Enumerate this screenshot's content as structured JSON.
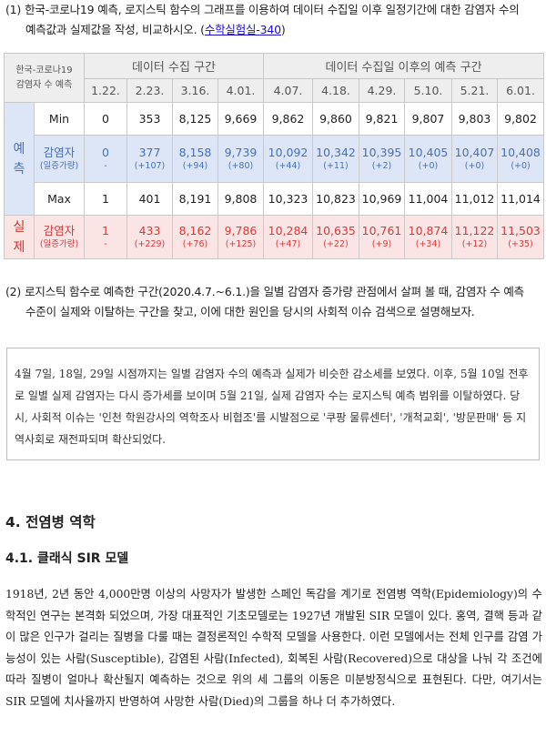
{
  "q1": {
    "num": "(1)",
    "line1": "한국-코로나19 예측, 로지스틱 함수의 그래프를 이용하여 데이터 수집일 이후 일정기간에 대한 감염자 수의",
    "line2_prefix": "예측값과 실제값을 작성, 비교하시오. (",
    "link": "수학실험실-340",
    "line2_suffix": ")"
  },
  "table": {
    "corner_line1": "한국-코로나19",
    "corner_line2": "감염자 수 예측",
    "group_collect": "데이터 수집 구간",
    "group_forecast": "데이터 수집일 이후의 예측 구간",
    "dates": [
      "1.22.",
      "2.23.",
      "3.16.",
      "4.01.",
      "4.07.",
      "4.18.",
      "4.29.",
      "5.10.",
      "5.21.",
      "6.01."
    ],
    "pred_label_1": "예",
    "pred_label_2": "측",
    "real_label_1": "실",
    "real_label_2": "제",
    "min_label": "Min",
    "min": [
      "0",
      "353",
      "8,125",
      "9,669",
      "9,862",
      "9,860",
      "9,821",
      "9,807",
      "9,803",
      "9,802"
    ],
    "pred_label": "감염자",
    "pred_sub": "(일증가량)",
    "pred": [
      "0",
      "377",
      "8,158",
      "9,739",
      "10,092",
      "10,342",
      "10,395",
      "10,405",
      "10,407",
      "10,408"
    ],
    "pred_delta": [
      "-",
      "(+107)",
      "(+94)",
      "(+80)",
      "(+44)",
      "(+11)",
      "(+2)",
      "(+0)",
      "(+0)",
      "(+0)"
    ],
    "max_label": "Max",
    "max": [
      "1",
      "401",
      "8,191",
      "9,808",
      "10,323",
      "10,823",
      "10,969",
      "11,004",
      "11,012",
      "11,014"
    ],
    "real_label": "감염자",
    "real_sub": "(일증가량)",
    "real": [
      "1",
      "433",
      "8,162",
      "9,786",
      "10,284",
      "10,635",
      "10,761",
      "10,874",
      "11,122",
      "11,503"
    ],
    "real_delta": [
      "-",
      "(+229)",
      "(+76)",
      "(+125)",
      "(+47)",
      "(+22)",
      "(+9)",
      "(+34)",
      "(+12)",
      "(+35)"
    ]
  },
  "q2": {
    "num": "(2)",
    "line1": "로지스틱 함수로 예측한 구간(2020.4.7.~6.1.)을 일별 감염자 증가량 관점에서 살펴 볼 때, 감염자 수 예측",
    "line2": "수준이 실제와 이탈하는 구간을 찾고, 이에 대한 원인을 당시의 사회적 이슈 검색으로 설명해보자."
  },
  "answer": "4월 7일, 18일, 29일 시점까지는 일별 감염자 수의 예측과 실제가 비슷한 감소세를 보였다. 이후, 5월 10일 전후로 일별 실제 감염자는 다시 증가세를 보이며 5월 21일, 실제 감염자 수는 로지스틱 예측 범위를 이탈하였다. 당시, 사회적 이슈는 '인천 학원강사의 역학조사 비협조'를 시발점으로 '쿠팡 물류센터', '개척교회', '방문판매' 등 지역사회로 재전파되며 확산되었다.",
  "section_title": "4. 전염병 역학",
  "subsection_title": "4.1. 클래식 SIR 모델",
  "body": "1918년, 2년 동안 4,000만명 이상의 사망자가 발생한 스페인 독감을 계기로 전염병 역학(Epidemiology)의 수학적인 연구는 본격화 되었으며, 가장 대표적인 기초모델로는 1927년 개발된 SIR 모델이 있다. 홍역, 결핵 등과 같이 많은 인구가 걸리는 질병을 다룰 때는 결정론적인 수학적 모델을 사용한다. 이런 모델에서는 전체 인구를 감염 가능성이 있는 사람(Susceptible), 감염된 사람(Infected), 회복된 사람(Recovered)으로 대상을 나눠 각 조건에 따라 질병이 얼마나 확산될지 예측하는 것으로 위의 세 그룹의 이동은 미분방정식으로 표현된다. 다만, 여기서는 SIR 모델에 치사율까지 반영하여 사망한 사람(Died)의 그룹을 하나 더 추가하였다."
}
